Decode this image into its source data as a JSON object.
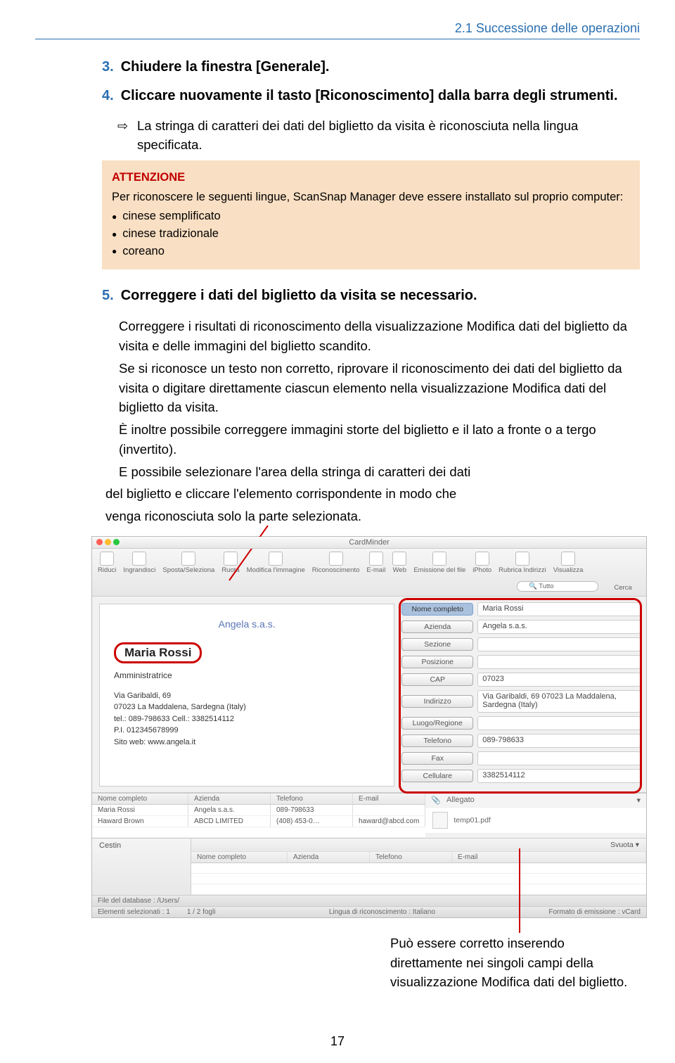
{
  "header": {
    "section": "2.1 Successione delle operazioni"
  },
  "steps": {
    "s3": {
      "num": "3.",
      "text": "Chiudere la finestra [Generale]."
    },
    "s4": {
      "num": "4.",
      "text": "Cliccare nuovamente il tasto [Riconoscimento] dalla barra degli strumenti."
    },
    "s4_result": "La stringa di caratteri dei dati del biglietto da visita è riconosciuta nella lingua specificata.",
    "s5": {
      "num": "5.",
      "text": "Correggere i dati del biglietto da visita se necessario."
    }
  },
  "attention": {
    "title": "ATTENZIONE",
    "intro": "Per riconoscere le seguenti lingue, ScanSnap Manager deve essere installato sul proprio computer:",
    "items": [
      "cinese semplificato",
      "cinese tradizionale",
      "coreano"
    ]
  },
  "body": {
    "p1": "Correggere i risultati di riconoscimento della visualizzazione Modifica dati del biglietto da visita e delle immagini del biglietto scandito.",
    "p2": "Se si riconosce un testo non corretto, riprovare il riconoscimento dei dati del biglietto da visita o digitare direttamente ciascun elemento nella visualizzazione Modifica dati del biglietto da visita.",
    "p3": "È inoltre possibile correggere immagini storte del biglietto e il lato a fronte o a tergo (invertito).",
    "p4a": "E possibile selezionare l'area della stringa di caratteri dei dati",
    "p4b": "del biglietto e cliccare l'elemento corrispondente in modo che",
    "p4c": "venga riconosciuta solo la parte selezionata."
  },
  "screenshot": {
    "title": "CardMinder",
    "toolbar": [
      "Riduci",
      "Ingrandisci",
      "Sposta/Seleziona",
      "Ruota",
      "Modifica l'immagine",
      "Riconoscimento",
      "E-mail",
      "Web",
      "Emissione del file",
      "iPhoto",
      "Rubrica Indirizzi",
      "Visualizza"
    ],
    "search_label": "Cerca",
    "search_placeholder": "Tutto",
    "card": {
      "company": "Angela s.a.s.",
      "name": "Maria Rossi",
      "role": "Amministratrice",
      "addr1": "Via Garibaldi, 69",
      "addr2": "07023 La Maddalena, Sardegna (Italy)",
      "tel": "tel.: 089-798633   Cell.: 3382514112",
      "pi": "P.I. 012345678999",
      "web": "Sito web: www.angela.it"
    },
    "fields": [
      {
        "label": "Nome completo",
        "value": "Maria Rossi",
        "sel": true
      },
      {
        "label": "Azienda",
        "value": "Angela s.a.s."
      },
      {
        "label": "Sezione",
        "value": ""
      },
      {
        "label": "Posizione",
        "value": ""
      },
      {
        "label": "CAP",
        "value": "07023"
      },
      {
        "label": "Indirizzo",
        "value": "Via Garibaldi, 69 07023 La Maddalena, Sardegna (Italy)"
      },
      {
        "label": "Luogo/Regione",
        "value": ""
      },
      {
        "label": "Telefono",
        "value": "089-798633"
      },
      {
        "label": "Fax",
        "value": ""
      },
      {
        "label": "Cellulare",
        "value": "3382514112"
      }
    ],
    "table": {
      "headers": [
        "Nome completo",
        "Azienda",
        "Telefono",
        "E-mail"
      ],
      "rows": [
        [
          "Maria Rossi",
          "Angela s.a.s.",
          "089-798633",
          ""
        ],
        [
          "Haward Brown",
          "ABCD LIMITED",
          "(408) 453-0…",
          "haward@abcd.com"
        ]
      ]
    },
    "attach_label": "Allegato",
    "attach_file": "temp01.pdf",
    "trash": "Cestin",
    "svuota": "Svuota",
    "status": {
      "db": "File del database : /Users/",
      "sel": "Elementi selezionati : 1",
      "pages": "1 / 2 fogli",
      "lang": "Lingua di riconoscimento : Italiano",
      "fmt": "Formato di emissione : vCard"
    }
  },
  "caption": "Può essere corretto inserendo direttamente nei singoli campi della visualizzazione Modifica dati del biglietto.",
  "page_number": "17"
}
